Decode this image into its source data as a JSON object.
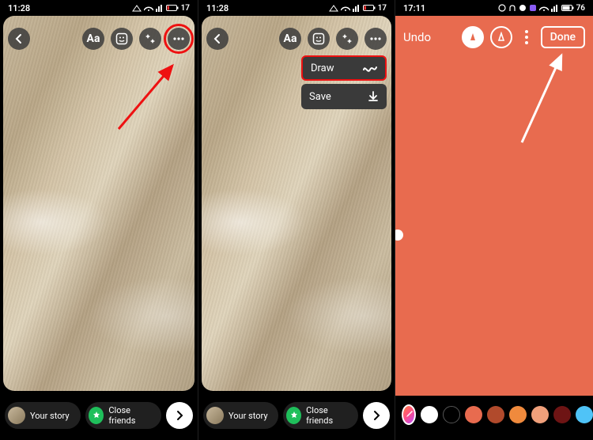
{
  "panel1": {
    "status": {
      "time": "11:28",
      "battery": "17"
    },
    "toolbar": {
      "text_tool": "Aa"
    },
    "bottom": {
      "your_story": "Your story",
      "close_friends": "Close friends"
    }
  },
  "panel2": {
    "status": {
      "time": "11:28",
      "battery": "17"
    },
    "toolbar": {
      "text_tool": "Aa"
    },
    "menu": {
      "draw": "Draw",
      "save": "Save"
    },
    "bottom": {
      "your_story": "Your story",
      "close_friends": "Close friends"
    }
  },
  "panel3": {
    "status": {
      "time": "17:11",
      "battery": "76"
    },
    "topbar": {
      "undo": "Undo",
      "done": "Done"
    },
    "fill_color": "#e86b4f",
    "palette": [
      "#ffffff",
      "#000000",
      "#e86b4f",
      "#b14a2c",
      "#f08a3d",
      "#f0a07b",
      "#6e1414",
      "#4fc3f7",
      "#2196f3"
    ]
  }
}
